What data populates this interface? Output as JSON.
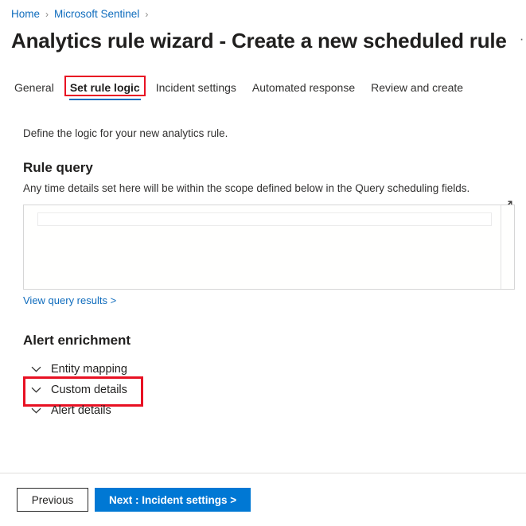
{
  "breadcrumb": {
    "items": [
      {
        "label": "Home"
      },
      {
        "label": "Microsoft Sentinel"
      }
    ],
    "separator": "›"
  },
  "header": {
    "title": "Analytics rule wizard - Create a new scheduled rule",
    "more_menu": "···"
  },
  "tabs": [
    {
      "label": "General",
      "active": false,
      "highlighted": false
    },
    {
      "label": "Set rule logic",
      "active": true,
      "highlighted": true
    },
    {
      "label": "Incident settings",
      "active": false,
      "highlighted": false
    },
    {
      "label": "Automated response",
      "active": false,
      "highlighted": false
    },
    {
      "label": "Review and create",
      "active": false,
      "highlighted": false
    }
  ],
  "main": {
    "intro": "Define the logic for your new analytics rule.",
    "rule_query": {
      "heading": "Rule query",
      "description": "Any time details set here will be within the scope defined below in the Query scheduling fields.",
      "expand_icon": "expand-diagonal-icon",
      "editor_value": "",
      "results_link": "View query results >"
    },
    "alert_enrichment": {
      "heading": "Alert enrichment",
      "sections": [
        {
          "label": "Entity mapping",
          "expanded": false,
          "highlighted": false
        },
        {
          "label": "Custom details",
          "expanded": false,
          "highlighted": true
        },
        {
          "label": "Alert details",
          "expanded": false,
          "highlighted": false
        }
      ]
    }
  },
  "footer": {
    "previous_label": "Previous",
    "next_label": "Next : Incident settings >"
  },
  "colors": {
    "link_blue": "#0f6cbd",
    "primary_blue": "#0078d4",
    "highlight_red": "#e81123",
    "active_tab_underline": "#0f6cbd"
  }
}
